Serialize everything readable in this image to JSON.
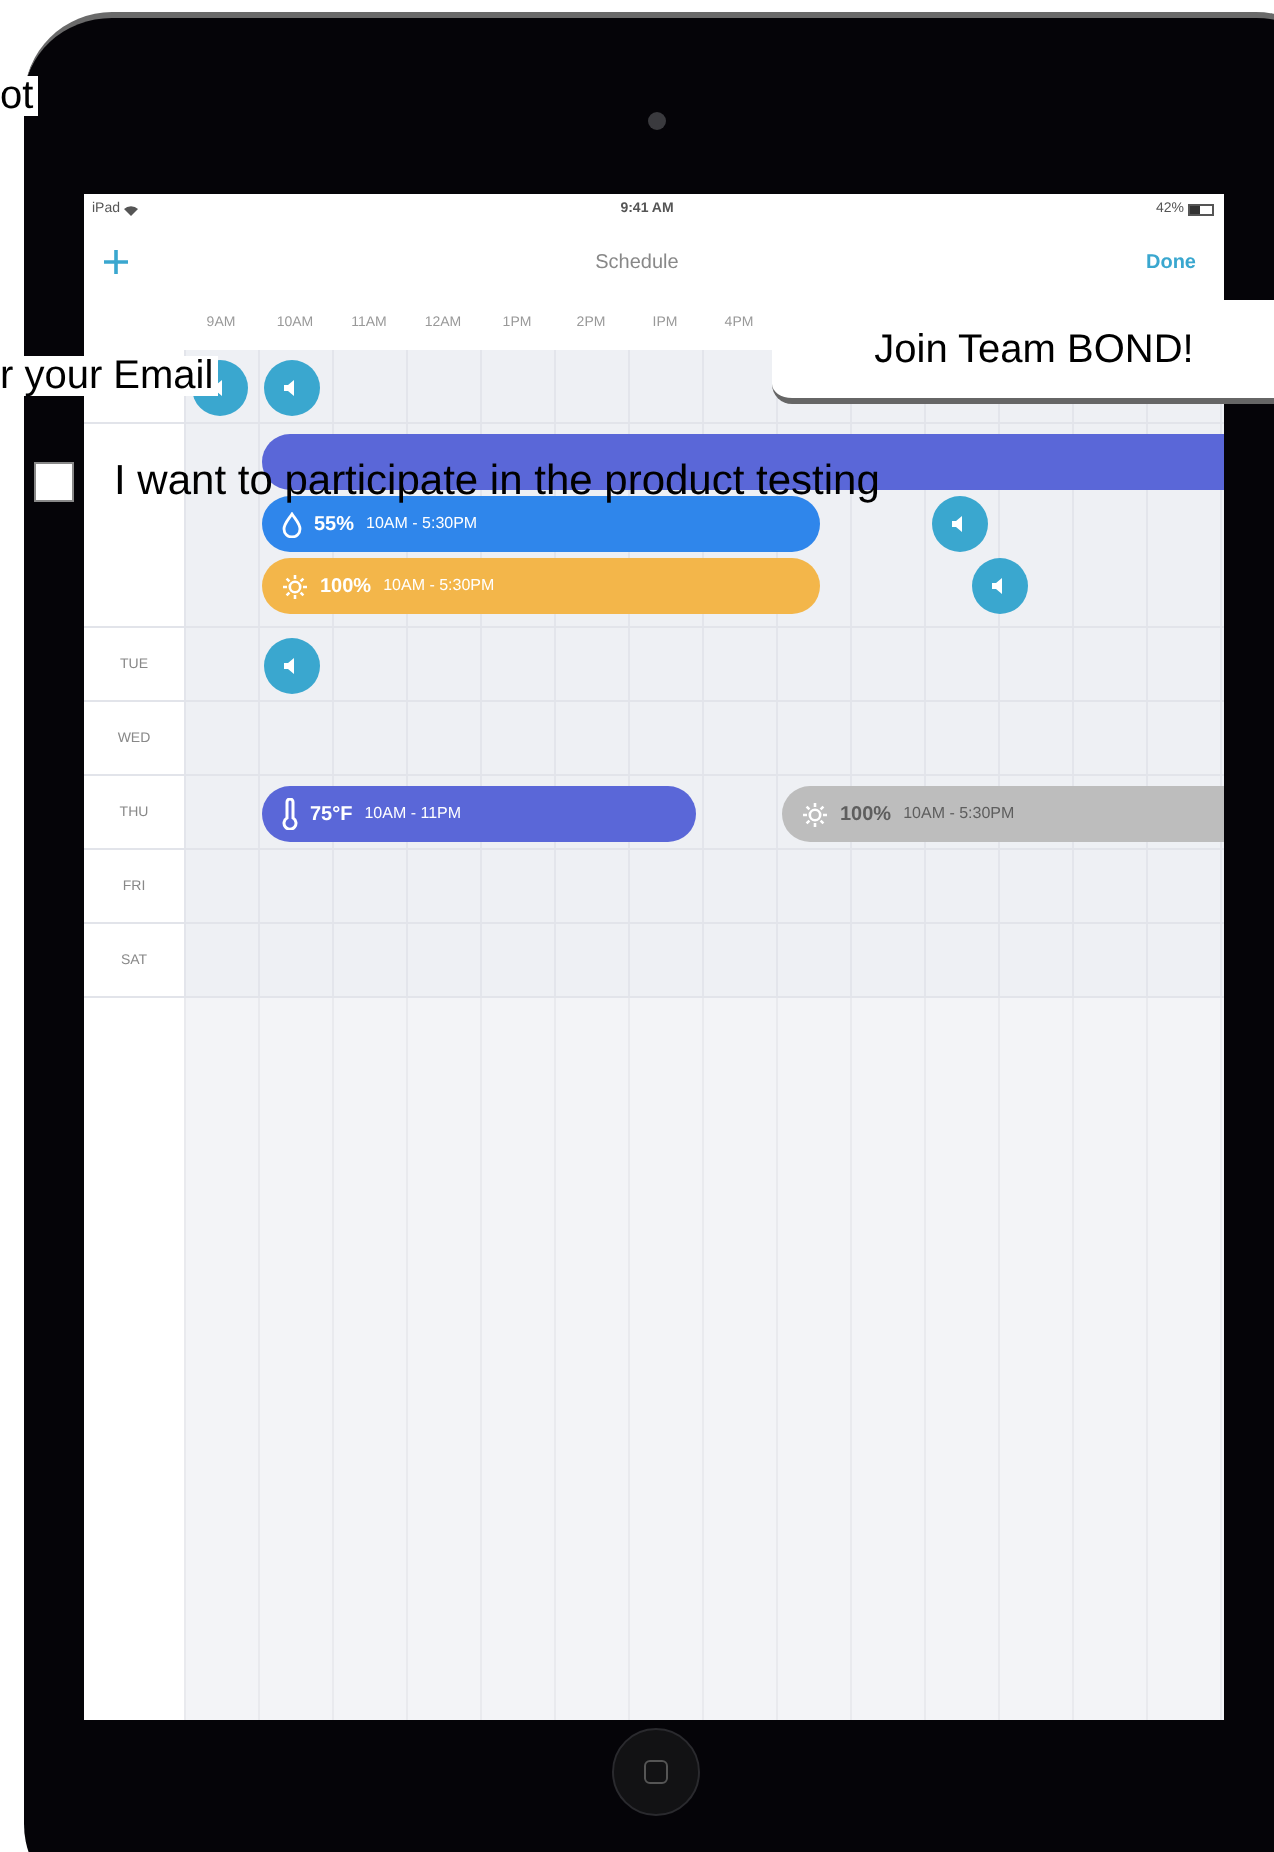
{
  "page_texts": {
    "top_fragment": "ot",
    "email_label": "r your Email"
  },
  "consent": {
    "label": "I want to participate in the product testing",
    "checked": false
  },
  "join_button": {
    "label": "Join Team BOND!"
  },
  "tablet": {
    "status_bar": {
      "carrier": "iPad",
      "time": "9:41 AM",
      "battery": "42%"
    },
    "nav": {
      "title": "Schedule",
      "action": "Done"
    },
    "hours": [
      "9AM",
      "10AM",
      "11AM",
      "12AM",
      "1PM",
      "2PM",
      "IPM",
      "4PM"
    ],
    "days": [
      {
        "events": [
          {
            "kind": "speaker"
          },
          {
            "kind": "speaker"
          }
        ]
      },
      {
        "events": [
          {
            "kind": "temperature",
            "color": "#5a67d8"
          },
          {
            "kind": "humidity",
            "color": "#2f86eb",
            "value": "55%",
            "time": "10AM - 5:30PM"
          },
          {
            "kind": "light",
            "color": "#f3b64a",
            "value": "100%",
            "time": "10AM - 5:30PM"
          },
          {
            "kind": "speaker"
          },
          {
            "kind": "speaker"
          }
        ]
      },
      {
        "label": "TUE",
        "events": [
          {
            "kind": "speaker"
          }
        ]
      },
      {
        "label": "WED"
      },
      {
        "label": "THU",
        "events": [
          {
            "kind": "temperature",
            "color": "#5a67d8",
            "value": "75°F",
            "time": "10AM - 11PM"
          },
          {
            "kind": "light",
            "color": "#bdbdbd",
            "value": "100%",
            "time": "10AM - 5:30PM"
          }
        ]
      },
      {
        "label": "FRI"
      },
      {
        "label": "SAT"
      }
    ]
  }
}
